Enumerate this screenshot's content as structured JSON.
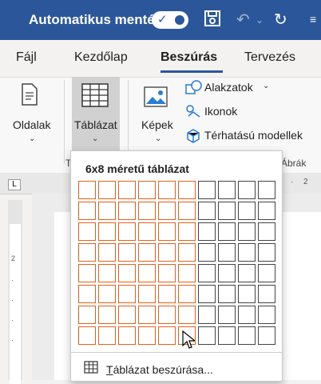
{
  "titlebar": {
    "autosave_label": "Automatikus mentés",
    "accent": "#2b579a"
  },
  "tabs": [
    {
      "label": "Fájl"
    },
    {
      "label": "Kezdőlap"
    },
    {
      "label": "Beszúrás",
      "active": true
    },
    {
      "label": "Tervezés"
    }
  ],
  "ribbon": {
    "oldalak": "Oldalak",
    "tablazat": "Táblázat",
    "kepek": "Képek",
    "alakzatok": "Alakzatok",
    "ikonok": "Ikonok",
    "modellek": "Térhatású modellek",
    "group_tablazat": "T",
    "group_abrak": "Ábrák"
  },
  "dropdown": {
    "title": "6x8 méretű táblázat",
    "rows": 8,
    "cols": 10,
    "selected_cols": 6,
    "selected_rows": 8,
    "highlight_color": "#e2611a",
    "insert_label": "Táblázat beszúrása...",
    "insert_underline_char": "T"
  },
  "ruler": {
    "h_tick_right": "2",
    "v_tick": "2"
  }
}
